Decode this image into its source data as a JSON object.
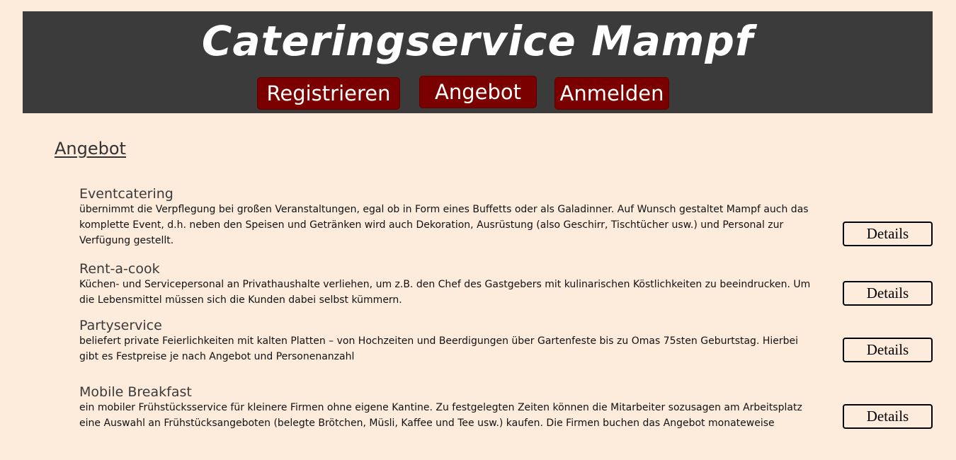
{
  "header": {
    "site_title": "Cateringservice Mampf",
    "nav": {
      "register": "Registrieren",
      "offer": "Angebot",
      "login": "Anmelden"
    }
  },
  "main": {
    "page_title": "Angebot",
    "offers": [
      {
        "name": "Eventcatering",
        "description": "übernimmt die Verpflegung bei großen Veranstaltungen, egal ob in Form eines Buffetts oder als Galadinner. Auf Wunsch gestaltet Mampf auch das komplette Event, d.h. neben den Speisen und Getränken wird auch Dekoration, Ausrüstung (also Geschirr, Tischtücher usw.) und Personal zur Verfügung gestellt.",
        "button": "Details"
      },
      {
        "name": "Rent-a-cook",
        "description": "Küchen- und Servicepersonal an Privathaushalte verliehen, um z.B. den Chef des Gastgebers mit kulinarischen Köstlichkeiten zu beeindrucken. Um die Lebensmittel müssen sich die Kunden dabei selbst kümmern.",
        "button": "Details"
      },
      {
        "name": "Partyservice",
        "description": "beliefert private Feierlichkeiten mit kalten Platten – von Hochzeiten und Beerdigungen über Gartenfeste bis zu Omas 75sten Geburtstag. Hierbei gibt es Festpreise je nach Angebot und Personenanzahl",
        "button": "Details"
      },
      {
        "name": "Mobile Breakfast",
        "description": "ein mobiler Frühstücksservice für kleinere Firmen ohne eigene Kantine. Zu festgelegten Zeiten können die Mitarbeiter sozusagen am Arbeitsplatz eine Auswahl an Frühstücksangeboten (belegte Brötchen, Müsli, Kaffee und Tee usw.) kaufen. Die Firmen buchen das Angebot monateweise",
        "button": "Details"
      }
    ]
  },
  "colors": {
    "page_background": "#fdebdc",
    "header_background": "#3b3b3b",
    "nav_button": "#7a0000"
  }
}
